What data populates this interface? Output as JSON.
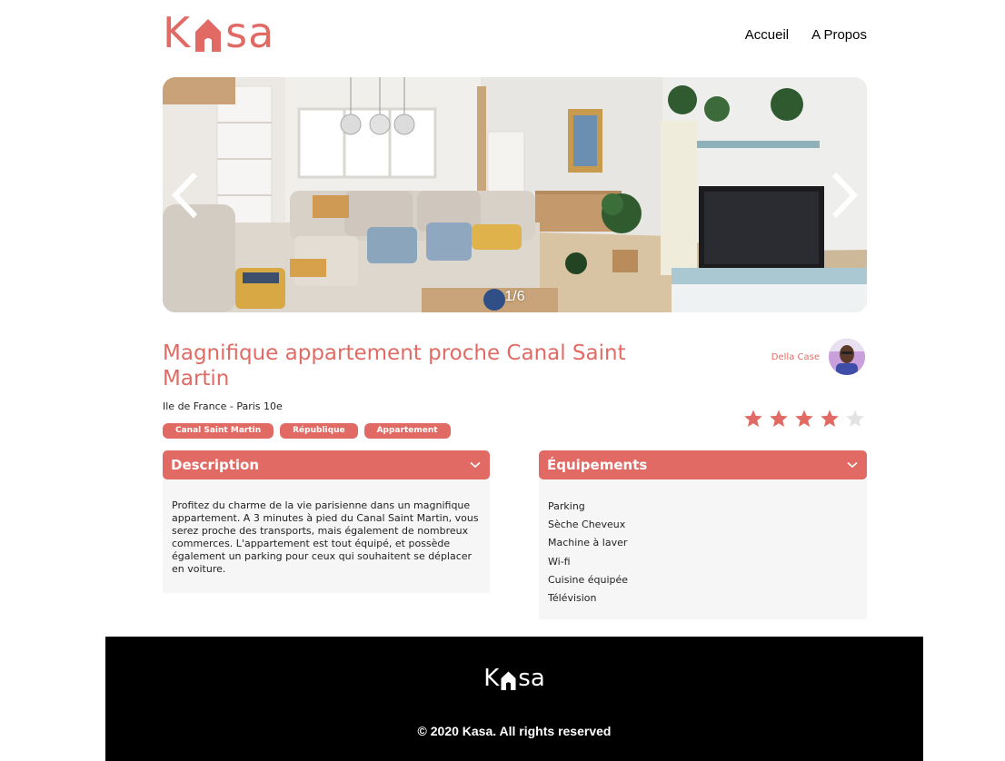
{
  "header": {
    "logo": {
      "letter_left": "K",
      "letters_right": "sa",
      "icon": "house-icon",
      "color": "#e16b64"
    },
    "nav": [
      {
        "label": "Accueil"
      },
      {
        "label": "A Propos"
      }
    ]
  },
  "carousel": {
    "counter": "1/6",
    "left_icon": "chevron-left-icon",
    "right_icon": "chevron-right-icon"
  },
  "listing": {
    "title": "Magnifique appartement proche Canal Saint Martin",
    "location": "Ile de France - Paris 10e",
    "tags": [
      "Canal Saint Martin",
      "République",
      "Appartement"
    ],
    "host": {
      "name": "Della Case"
    },
    "rating": {
      "value": 4,
      "max": 5
    }
  },
  "description": {
    "title": "Description",
    "text": "Profitez du charme de la vie parisienne dans un magnifique appartement. A 3 minutes à pied du Canal Saint Martin, vous serez proche des transports, mais également de nombreux commerces. L'appartement est tout équipé, et possède également un parking pour ceux qui souhaitent se déplacer en voiture."
  },
  "equipments": {
    "title": "Équipements",
    "items": [
      "Parking",
      "Sèche Cheveux",
      "Machine à laver",
      "Wi-fi",
      "Cuisine équipée",
      "Télévision"
    ]
  },
  "footer": {
    "logo": {
      "letter_left": "K",
      "letters_right": "sa"
    },
    "copyright": "© 2020 Kasa. All rights reserved"
  },
  "colors": {
    "accent": "#e16b64",
    "star_off": "#e3e3e3",
    "panel_bg": "#f6f6f6",
    "footer_bg": "#000000"
  }
}
